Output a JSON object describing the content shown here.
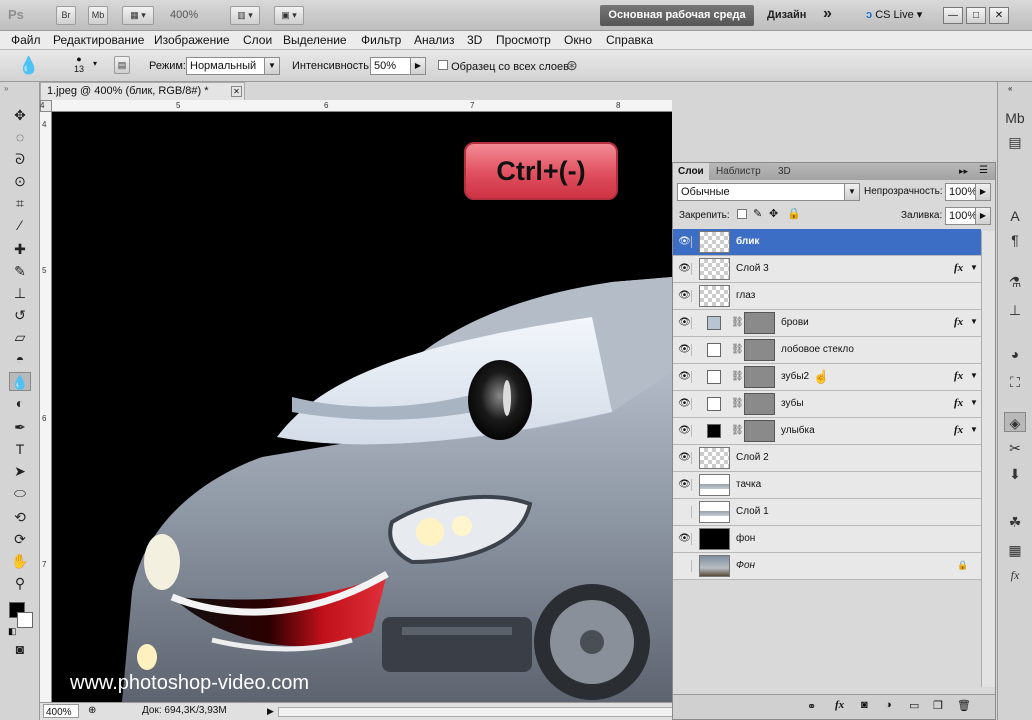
{
  "app": {
    "logo": "Ps",
    "bridge": "Br",
    "minibridge": "Mb",
    "zoom": "400%",
    "workspace_active": "Основная рабочая среда",
    "workspace_design": "Дизайн",
    "more": "»",
    "cslive": "CS Live",
    "win_min": "—",
    "win_max": "□",
    "win_close": "✕"
  },
  "menu": [
    "Файл",
    "Редактирование",
    "Изображение",
    "Слои",
    "Выделение",
    "Фильтр",
    "Анализ",
    "3D",
    "Просмотр",
    "Окно",
    "Справка"
  ],
  "options": {
    "brush_size": "13",
    "mode_label": "Режим:",
    "mode_value": "Нормальный",
    "intensity_label": "Интенсивность:",
    "intensity_value": "50%",
    "sample_all": "Образец со всех слоев"
  },
  "document": {
    "tab_title": "1.jpeg @ 400% (блик, RGB/8#) *",
    "ruler_top": [
      "4",
      "5",
      "6",
      "7",
      "8",
      "9"
    ],
    "ruler_left": [
      "4",
      "5",
      "6",
      "7"
    ],
    "status_zoom": "400%",
    "status_doc": "Док: 694,3K/3,93M"
  },
  "overlay": {
    "shortcut": "Ctrl+(-)",
    "watermark": "www.photoshop-video.com"
  },
  "layers_panel": {
    "tabs": [
      "Слои",
      "Наблистр",
      "3D"
    ],
    "blend_mode": "Обычные",
    "opacity_label": "Непрозрачность:",
    "opacity_value": "100%",
    "lock_label": "Закрепить:",
    "fill_label": "Заливка:",
    "fill_value": "100%",
    "fx": "fx",
    "layers": [
      {
        "name": "блик",
        "selected": true,
        "visible": true,
        "kind": "transparent",
        "fx": false
      },
      {
        "name": "Слой 3",
        "selected": false,
        "visible": true,
        "kind": "transparent",
        "fx": true
      },
      {
        "name": "глаз",
        "selected": false,
        "visible": true,
        "kind": "transparent",
        "fx": false
      },
      {
        "name": "брови",
        "selected": false,
        "visible": true,
        "kind": "shape",
        "swatch": "#b8c4d2",
        "fx": true
      },
      {
        "name": "лобовое стекло",
        "selected": false,
        "visible": true,
        "kind": "shape",
        "swatch": "#ffffff",
        "fx": false
      },
      {
        "name": "зубы2",
        "selected": false,
        "visible": true,
        "kind": "shape",
        "swatch": "#ffffff",
        "fx": true
      },
      {
        "name": "зубы",
        "selected": false,
        "visible": true,
        "kind": "shape",
        "swatch": "#ffffff",
        "fx": true
      },
      {
        "name": "улыбка",
        "selected": false,
        "visible": true,
        "kind": "shape",
        "swatch": "#000000",
        "fx": true
      },
      {
        "name": "Слой 2",
        "selected": false,
        "visible": true,
        "kind": "transparent",
        "fx": false
      },
      {
        "name": "тачка",
        "selected": false,
        "visible": true,
        "kind": "car",
        "fx": false
      },
      {
        "name": "Слой 1",
        "selected": false,
        "visible": false,
        "kind": "car",
        "fx": false
      },
      {
        "name": "фон",
        "selected": false,
        "visible": true,
        "kind": "black",
        "fx": false
      },
      {
        "name": "Фон",
        "selected": false,
        "visible": false,
        "kind": "photo",
        "fx": false,
        "locked": true
      }
    ]
  }
}
